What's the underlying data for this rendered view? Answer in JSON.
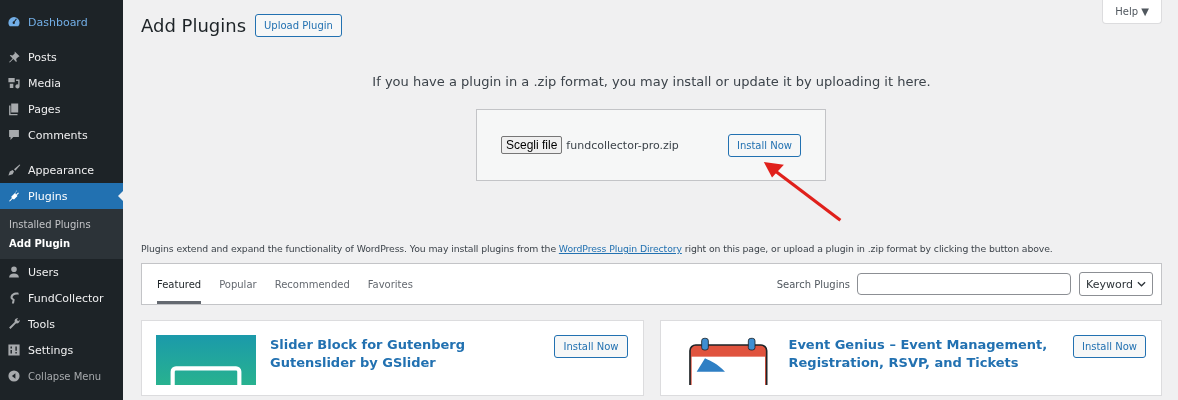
{
  "sidebar": {
    "groups": [
      {
        "items": [
          {
            "label": "Dashboard",
            "selected": false,
            "hovered": true
          }
        ]
      },
      {
        "items": [
          {
            "label": "Posts",
            "selected": false,
            "hovered": false
          },
          {
            "label": "Media",
            "selected": false,
            "hovered": false
          },
          {
            "label": "Pages",
            "selected": false,
            "hovered": false
          },
          {
            "label": "Comments",
            "selected": false,
            "hovered": false
          }
        ]
      },
      {
        "items": [
          {
            "label": "Appearance",
            "selected": false,
            "hovered": false
          },
          {
            "label": "Plugins",
            "selected": true,
            "hovered": false,
            "children": [
              {
                "label": "Installed Plugins",
                "selected": false
              },
              {
                "label": "Add Plugin",
                "selected": true
              }
            ]
          },
          {
            "label": "Users",
            "selected": false,
            "hovered": false
          },
          {
            "label": "FundCollector",
            "selected": false,
            "hovered": false
          },
          {
            "label": "Tools",
            "selected": false,
            "hovered": false
          },
          {
            "label": "Settings",
            "selected": false,
            "hovered": false
          }
        ]
      }
    ],
    "collapse": "Collapse Menu"
  },
  "help_button": "Help ▼",
  "title": "Add Plugins",
  "upload_button": "Upload Plugin",
  "upload": {
    "instructions": "If you have a plugin in a .zip format, you may install or update it by uploading it here.",
    "choose_button": "Scegli file",
    "file_name": "fundcollector-pro.zip",
    "install_button": "Install Now"
  },
  "description": {
    "before": "Plugins extend and expand the functionality of WordPress. You may install plugins from the ",
    "link": "WordPress Plugin Directory",
    "after": " right on this page, or upload a plugin in .zip format by clicking the button above."
  },
  "filter_tabs": [
    {
      "label": "Featured",
      "selected": true
    },
    {
      "label": "Popular",
      "selected": false
    },
    {
      "label": "Recommended",
      "selected": false
    },
    {
      "label": "Favorites",
      "selected": false
    }
  ],
  "search": {
    "label": "Search Plugins",
    "type": "Keyword"
  },
  "cards": [
    {
      "name": "Slider Block for Gutenberg Gutenslider by GSlider",
      "button": "Install Now"
    },
    {
      "name": "Event Genius – Event Management, Registration, RSVP, and Tickets",
      "button": "Install Now"
    }
  ]
}
